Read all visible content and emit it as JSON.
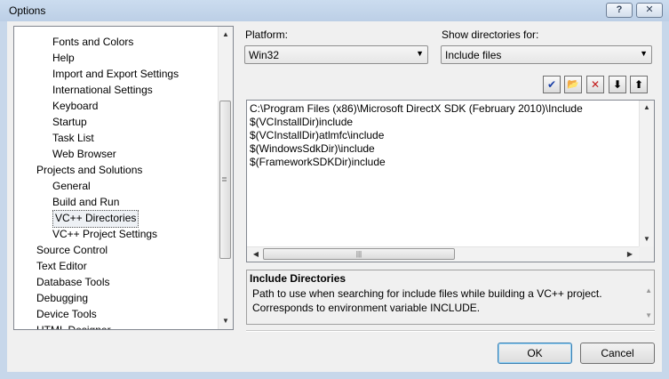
{
  "window": {
    "title": "Options",
    "help_glyph": "?",
    "close_glyph": "✕"
  },
  "tree": {
    "items": [
      {
        "label": "Fonts and Colors",
        "level": 2
      },
      {
        "label": "Help",
        "level": 2
      },
      {
        "label": "Import and Export Settings",
        "level": 2
      },
      {
        "label": "International Settings",
        "level": 2
      },
      {
        "label": "Keyboard",
        "level": 2
      },
      {
        "label": "Startup",
        "level": 2
      },
      {
        "label": "Task List",
        "level": 2
      },
      {
        "label": "Web Browser",
        "level": 2
      },
      {
        "label": "Projects and Solutions",
        "level": 1
      },
      {
        "label": "General",
        "level": 2
      },
      {
        "label": "Build and Run",
        "level": 2
      },
      {
        "label": "VC++ Directories",
        "level": 2,
        "selected": true
      },
      {
        "label": "VC++ Project Settings",
        "level": 2
      },
      {
        "label": "Source Control",
        "level": 1
      },
      {
        "label": "Text Editor",
        "level": 1
      },
      {
        "label": "Database Tools",
        "level": 1
      },
      {
        "label": "Debugging",
        "level": 1
      },
      {
        "label": "Device Tools",
        "level": 1
      },
      {
        "label": "HTML Designer",
        "level": 1
      }
    ]
  },
  "platform": {
    "label": "Platform:",
    "value": "Win32"
  },
  "show_dirs": {
    "label": "Show directories for:",
    "value": "Include files"
  },
  "toolbar": {
    "check_glyph": "✔",
    "folder_glyph": "📂",
    "delete_glyph": "✕",
    "down_glyph": "⬇",
    "up_glyph": "⬆"
  },
  "directories": [
    "C:\\Program Files (x86)\\Microsoft DirectX SDK (February 2010)\\Include",
    "$(VCInstallDir)include",
    "$(VCInstallDir)atlmfc\\include",
    "$(WindowsSdkDir)\\include",
    "$(FrameworkSDKDir)include"
  ],
  "description": {
    "title": "Include Directories",
    "line1": "Path to use when searching for include files while building a VC++ project.",
    "line2": "Corresponds to environment variable INCLUDE."
  },
  "buttons": {
    "ok": "OK",
    "cancel": "Cancel"
  }
}
